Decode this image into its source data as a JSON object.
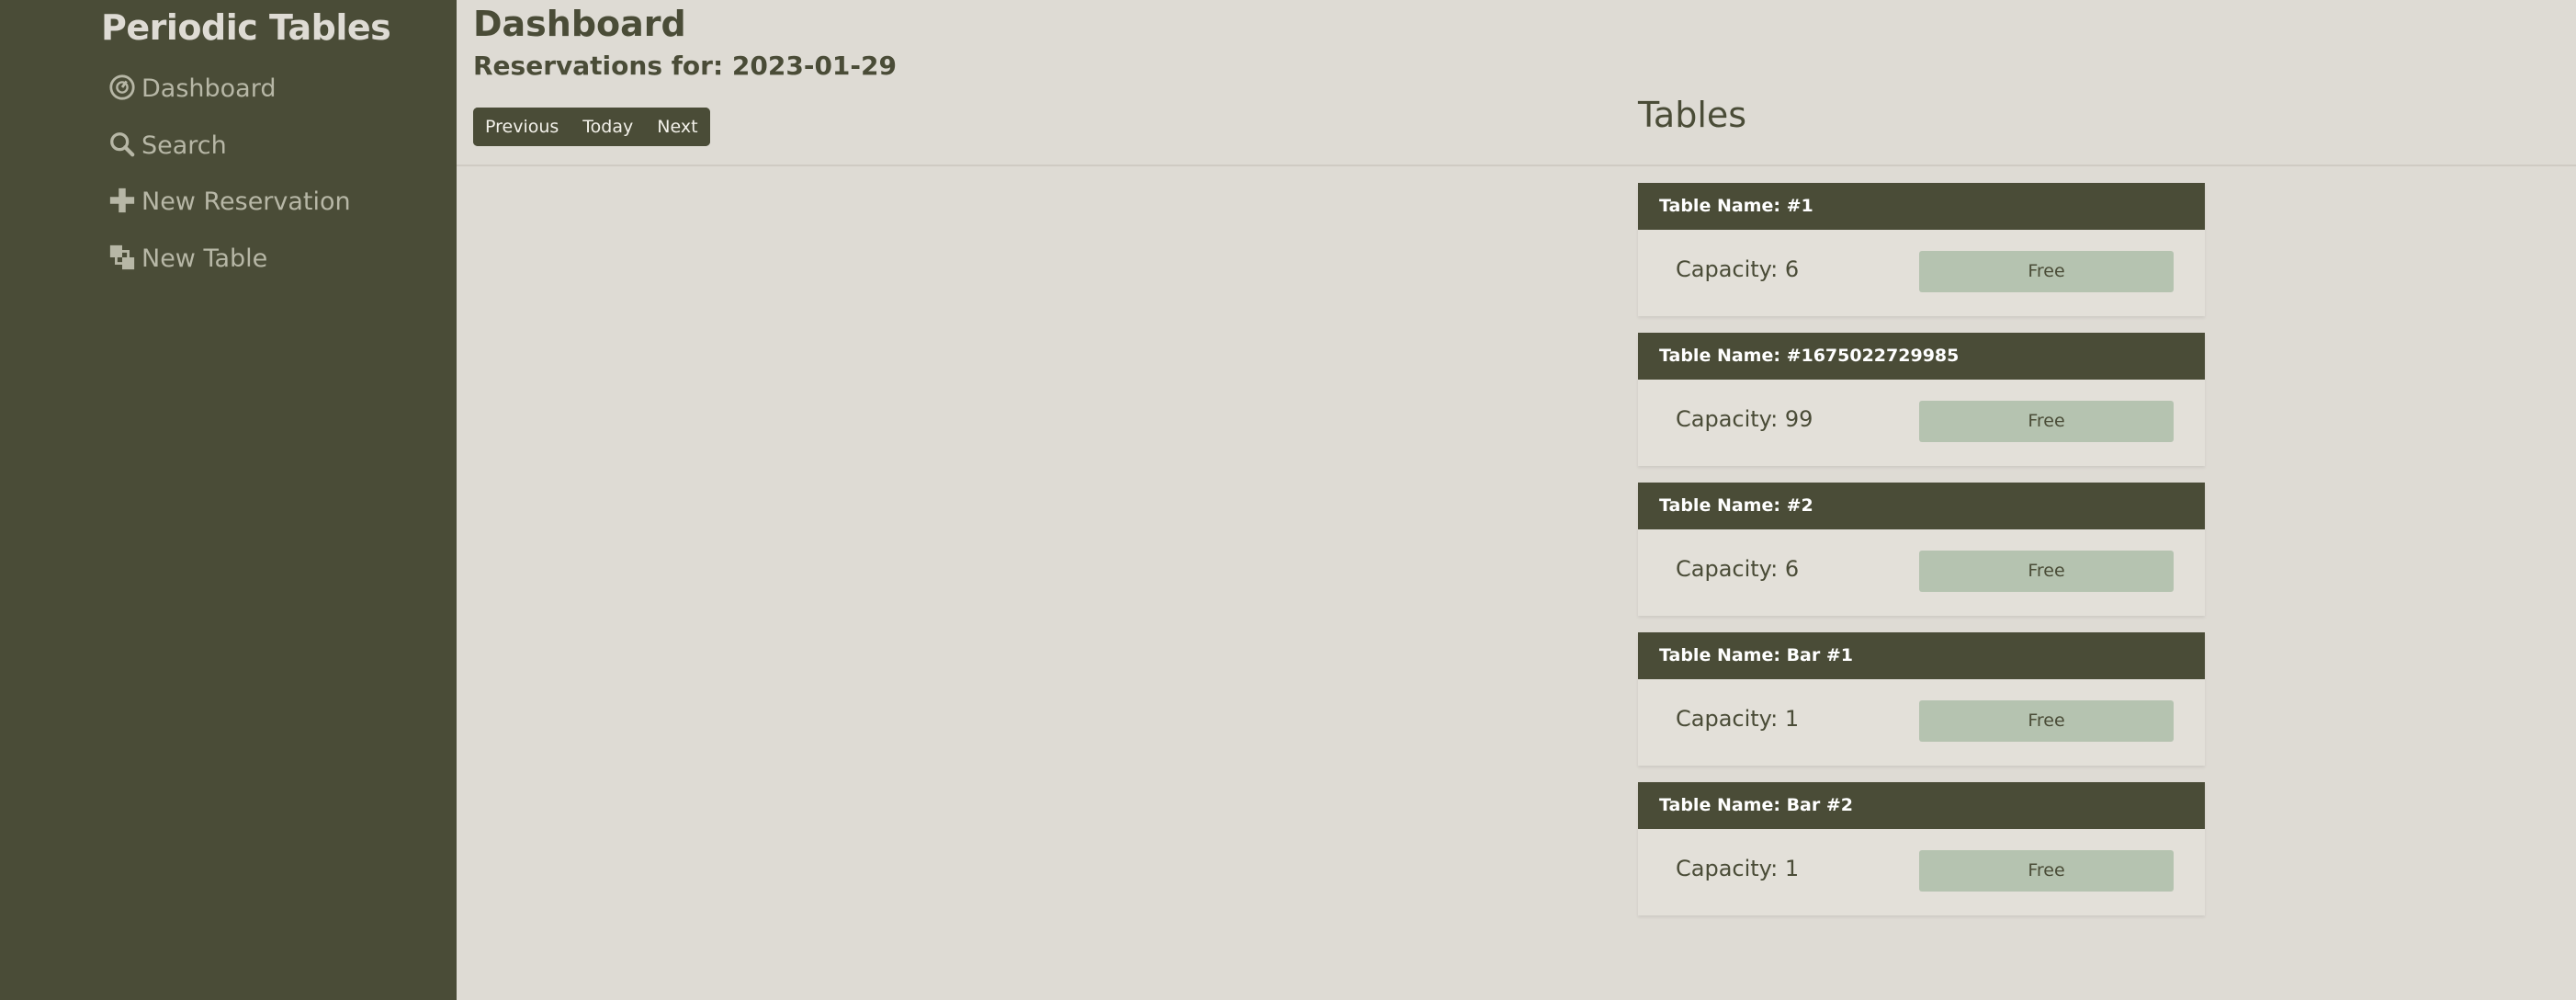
{
  "app": {
    "brand": "Periodic Tables"
  },
  "sidebar": {
    "items": [
      {
        "label": "Dashboard",
        "icon": "dashboard-icon"
      },
      {
        "label": "Search",
        "icon": "search-icon"
      },
      {
        "label": "New Reservation",
        "icon": "plus-icon"
      },
      {
        "label": "New Table",
        "icon": "layers-icon"
      }
    ]
  },
  "main": {
    "title": "Dashboard",
    "reservations_for": "Reservations for: 2023-01-29",
    "nav_buttons": {
      "previous": "Previous",
      "today": "Today",
      "next": "Next"
    },
    "tables_heading": "Tables",
    "tables": [
      {
        "name": "Table Name: #1",
        "capacity": "Capacity: 6",
        "status": "Free"
      },
      {
        "name": "Table Name: #1675022729985",
        "capacity": "Capacity: 99",
        "status": "Free"
      },
      {
        "name": "Table Name: #2",
        "capacity": "Capacity: 6",
        "status": "Free"
      },
      {
        "name": "Table Name: Bar #1",
        "capacity": "Capacity: 1",
        "status": "Free"
      },
      {
        "name": "Table Name: Bar #2",
        "capacity": "Capacity: 1",
        "status": "Free"
      }
    ]
  },
  "colors": {
    "sidebar": "#4a4c37",
    "background": "#dedbd4",
    "status_free": "#b5c3b0"
  }
}
